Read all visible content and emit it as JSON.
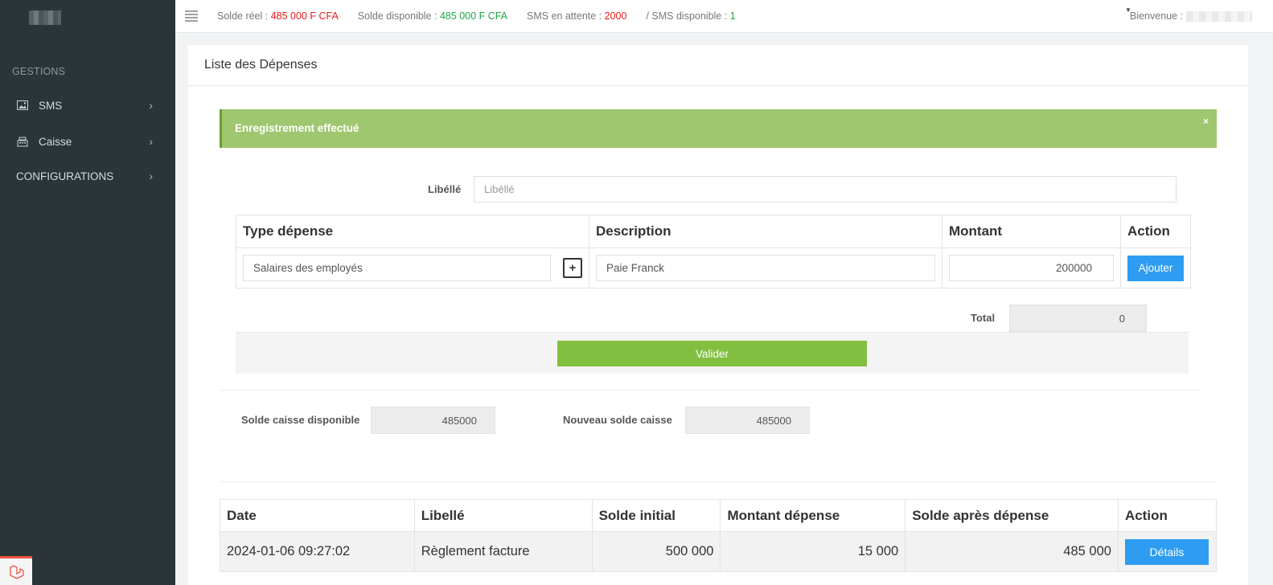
{
  "sidebar": {
    "section_gestions": "GESTIONS",
    "items": [
      {
        "label": "SMS",
        "icon": "image-icon"
      },
      {
        "label": "Caisse",
        "icon": "cash-register-icon"
      }
    ],
    "config_label": "CONFIGURATIONS"
  },
  "topbar": {
    "solde_reel_label": "Solde réel :",
    "solde_reel_value": "485 000 F CFA",
    "solde_dispo_label": "Solde disponible :",
    "solde_dispo_value": "485 000 F CFA",
    "sms_attente_label": "SMS en attente :",
    "sms_attente_value": "2000",
    "sms_dispo_label": "/ SMS disponible :",
    "sms_dispo_value": "1",
    "welcome_label": "Bienvenue :"
  },
  "panel": {
    "title": "Liste des Dépenses",
    "alert_message": "Enregistrement effectué",
    "alert_close": "×",
    "libelle_label": "Libéllé",
    "libelle_placeholder": "Libéllé",
    "expense_headers": [
      "Type dépense",
      "Description",
      "Montant",
      "Action"
    ],
    "expense_row": {
      "type": "Salaires des employés",
      "plus": "+",
      "description": "Paie Franck",
      "montant": "200000",
      "action": "Ajouter"
    },
    "total_label": "Total",
    "total_value": "0",
    "valider_label": "Valider",
    "solde_caisse_label": "Solde caisse disponible",
    "solde_caisse_value": "485000",
    "nouveau_solde_label": "Nouveau solde caisse",
    "nouveau_solde_value": "485000"
  },
  "history": {
    "headers": [
      "Date",
      "Libellé",
      "Solde initial",
      "Montant dépense",
      "Solde après dépense",
      "Action"
    ],
    "rows": [
      {
        "date": "2024-01-06 09:27:02",
        "libelle": "Règlement facture",
        "solde_initial": "500 000",
        "montant": "15 000",
        "solde_apres": "485 000",
        "action": "Détails"
      }
    ]
  },
  "colors": {
    "sidebar_bg": "#2b3539",
    "alert_bg": "#9fc76f",
    "btn_blue": "#2e9df1",
    "btn_green": "#82bf40",
    "red": "#e81a1a",
    "green": "#1da745"
  }
}
